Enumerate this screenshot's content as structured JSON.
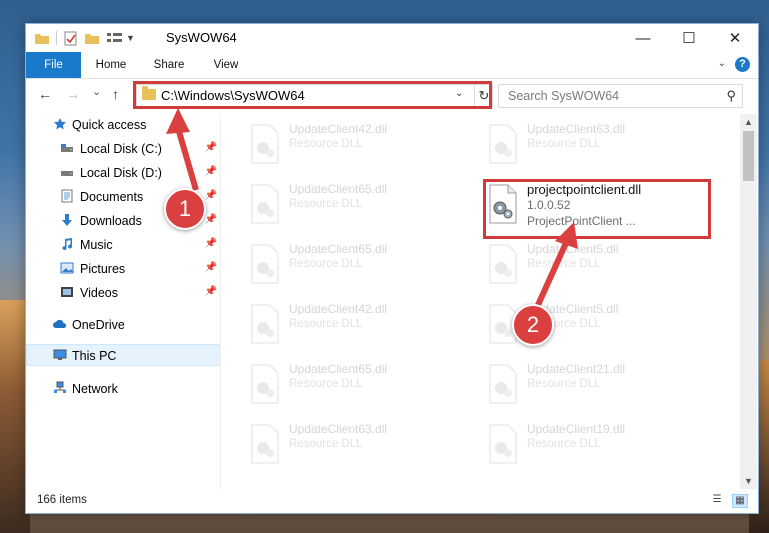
{
  "window": {
    "title": "SysWOW64",
    "controls": {
      "minimize": "—",
      "maximize": "☐",
      "close": "✕"
    }
  },
  "ribbon": {
    "tabs": [
      "File",
      "Home",
      "Share",
      "View"
    ],
    "help": "?"
  },
  "navbar": {
    "back": "←",
    "forward": "→",
    "recent": "⌄",
    "up": "↑",
    "address": "C:\\Windows\\SysWOW64",
    "address_dropdown": "⌄",
    "refresh": "↻",
    "search_placeholder": "Search SysWOW64",
    "search_icon": "search-icon"
  },
  "sidebar": {
    "items": [
      {
        "label": "Quick access",
        "icon": "star-icon",
        "pinned": false
      },
      {
        "label": "Local Disk (C:)",
        "icon": "drive-icon",
        "pinned": true
      },
      {
        "label": "Local Disk (D:)",
        "icon": "drive-icon",
        "pinned": true
      },
      {
        "label": "Documents",
        "icon": "documents-icon",
        "pinned": true
      },
      {
        "label": "Downloads",
        "icon": "download-icon",
        "pinned": true
      },
      {
        "label": "Music",
        "icon": "music-icon",
        "pinned": true
      },
      {
        "label": "Pictures",
        "icon": "pictures-icon",
        "pinned": true
      },
      {
        "label": "Videos",
        "icon": "videos-icon",
        "pinned": true
      },
      {
        "label": "OneDrive",
        "icon": "cloud-icon",
        "pinned": false
      },
      {
        "label": "This PC",
        "icon": "computer-icon",
        "pinned": false,
        "selected": true
      },
      {
        "label": "Network",
        "icon": "network-icon",
        "pinned": false
      }
    ],
    "pin_glyph": "📌"
  },
  "files": [
    {
      "name": "UpdateClient42.dll",
      "desc": "Resource DLL"
    },
    {
      "name": "UpdateClient63.dll",
      "desc": "Resource DLL"
    },
    {
      "name": "UpdateClient65.dll",
      "desc": "Resource DLL"
    },
    {
      "name": "projectpointclient.dll",
      "desc": "1.0.0.52",
      "desc2": "ProjectPointClient ...",
      "highlighted": true
    },
    {
      "name": "UpdateClient65.dll",
      "desc": "Resource DLL"
    },
    {
      "name": "UpdateClient5.dll",
      "desc": "Resource DLL"
    },
    {
      "name": "UpdateClient42.dll",
      "desc": "Resource DLL"
    },
    {
      "name": "UpdateClient5.dll",
      "desc": "Resource DLL"
    },
    {
      "name": "UpdateClient65.dll",
      "desc": "Resource DLL"
    },
    {
      "name": "UpdateClient21.dll",
      "desc": "Resource DLL"
    },
    {
      "name": "UpdateClient63.dll",
      "desc": "Resource DLL"
    },
    {
      "name": "UpdateClient19.dll",
      "desc": "Resource DLL"
    }
  ],
  "status": {
    "count": "166 items"
  },
  "annotations": {
    "step1": "1",
    "step2": "2",
    "color": "#d9403f"
  }
}
